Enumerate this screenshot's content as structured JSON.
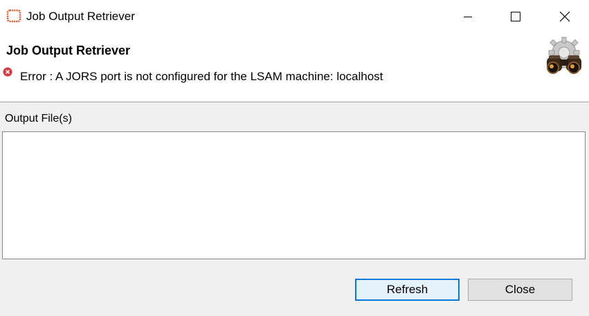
{
  "window": {
    "title": "Job Output Retriever",
    "controls": {
      "minimize_icon": "minimize-icon",
      "maximize_icon": "maximize-icon",
      "close_icon": "close-icon"
    }
  },
  "header": {
    "heading": "Job Output Retriever",
    "error_message": "Error : A JORS port is not configured for the LSAM machine: localhost",
    "error_icon": "error-icon",
    "banner_icon": "binoculars-gear-icon"
  },
  "output": {
    "label": "Output File(s)",
    "items": []
  },
  "buttons": {
    "refresh": "Refresh",
    "close": "Close"
  },
  "colors": {
    "accent_focus": "#0078d7",
    "app_icon": "#e8542a",
    "error": "#d9363e"
  }
}
